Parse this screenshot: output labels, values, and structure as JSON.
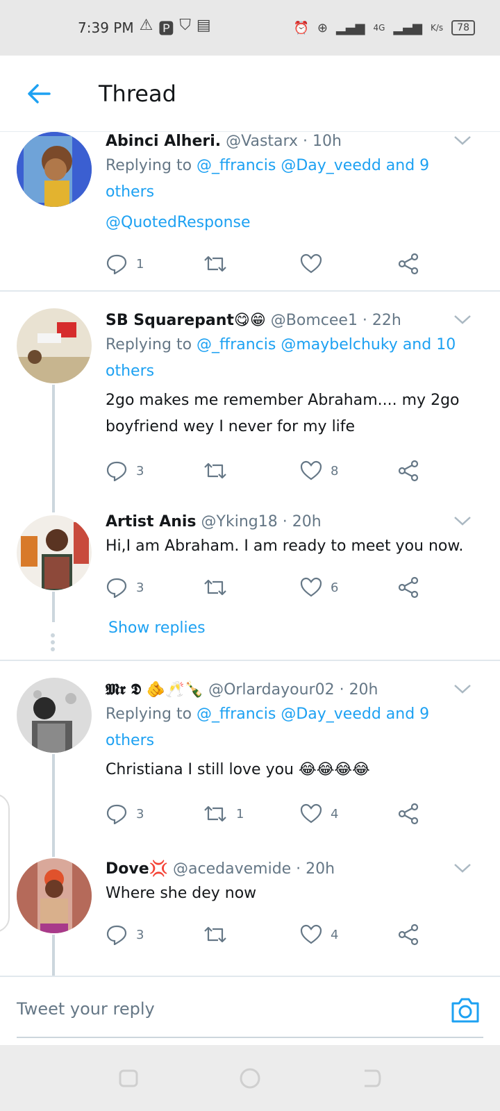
{
  "status_bar": {
    "time": "7:39 PM",
    "network": "4G",
    "speed": "K/s",
    "battery": "78"
  },
  "header": {
    "title": "Thread"
  },
  "tweets": [
    {
      "name": "Abinci Alheri.",
      "handle": "@Vastarx · 10h",
      "reply_prefix": "Replying to",
      "reply_targets": "@_ffrancis @Day_veedd and 9 others",
      "body": "@QuotedResponse",
      "replies": "1",
      "retweets": "",
      "likes": "",
      "avatar_color": "#3b5fd1"
    },
    {
      "name": "SB Squarepant😋😁",
      "handle": "@Bomcee1 · 22h",
      "reply_prefix": "Replying to",
      "reply_targets": "@_ffrancis @maybelchuky and 10 others",
      "body": "2go makes me remember Abraham.... my 2go boyfriend wey I never for my life",
      "replies": "3",
      "retweets": "",
      "likes": "8",
      "avatar_color": "#c9b38e"
    },
    {
      "name": "Artist Anis",
      "handle": "@Yking18 · 20h",
      "body": "Hi,I am Abraham. I am ready to meet you now.",
      "replies": "3",
      "retweets": "",
      "likes": "6",
      "avatar_color": "#b84a3a"
    },
    {
      "name": "𝕸𝖗 𝕯 🫵🥂🍾",
      "handle": "@Orlardayour02 · 20h",
      "reply_prefix": "Replying to",
      "reply_targets": "@_ffrancis @Day_veedd and 9 others",
      "body": "Christiana  I still love you 😂😂😂😂",
      "replies": "3",
      "retweets": "1",
      "likes": "4",
      "avatar_color": "#9aa0a6"
    },
    {
      "name": "Dove💢",
      "handle": "@acedavemide · 20h",
      "body": "Where she dey now",
      "replies": "3",
      "retweets": "",
      "likes": "4",
      "avatar_color": "#c46a55"
    }
  ],
  "show_replies": "Show replies",
  "reply_box": {
    "placeholder": "Tweet your reply"
  },
  "colors": {
    "accent": "#1da1f2",
    "muted": "#657786"
  }
}
